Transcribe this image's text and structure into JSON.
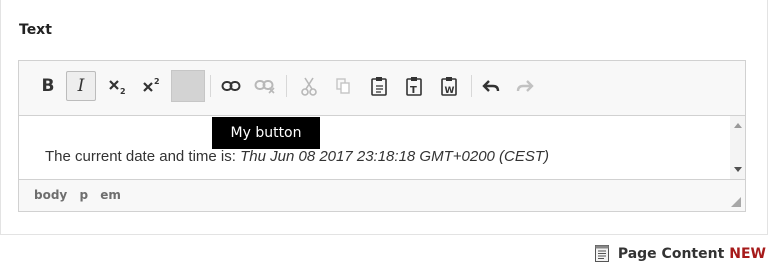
{
  "field": {
    "label": "Text"
  },
  "toolbar": {
    "buttons": [
      {
        "name": "bold-button",
        "icon": "bold-icon",
        "glyph": "B"
      },
      {
        "name": "italic-button",
        "icon": "italic-icon",
        "glyph": "I",
        "active": true
      },
      {
        "name": "subscript-button",
        "icon": "subscript-icon"
      },
      {
        "name": "superscript-button",
        "icon": "superscript-icon"
      },
      {
        "name": "color-swatch-button",
        "icon": "color-swatch-icon"
      },
      {
        "name": "link-button",
        "icon": "link-icon"
      },
      {
        "name": "unlink-button",
        "icon": "unlink-icon",
        "disabled": true
      },
      {
        "name": "cut-button",
        "icon": "cut-icon",
        "disabled": true
      },
      {
        "name": "copy-button",
        "icon": "copy-icon",
        "disabled": true
      },
      {
        "name": "paste-button",
        "icon": "paste-icon"
      },
      {
        "name": "paste-text-button",
        "icon": "paste-text-icon"
      },
      {
        "name": "paste-word-button",
        "icon": "paste-word-icon"
      },
      {
        "name": "undo-button",
        "icon": "undo-icon"
      },
      {
        "name": "redo-button",
        "icon": "redo-icon",
        "disabled": true
      }
    ]
  },
  "tooltip": {
    "text": "My button"
  },
  "editor": {
    "text_prefix": "The current date and time is: ",
    "text_italic": "Thu Jun 08 2017 23:18:18 GMT+0200 (CEST)"
  },
  "statusbar": {
    "path": [
      "body",
      "p",
      "em"
    ]
  },
  "footer": {
    "label": "Page Content",
    "badge": "NEW"
  },
  "colors": {
    "badge": "#a61a1a",
    "tooltip_bg": "#000000",
    "toolbar_bg": "#f8f8f8"
  }
}
